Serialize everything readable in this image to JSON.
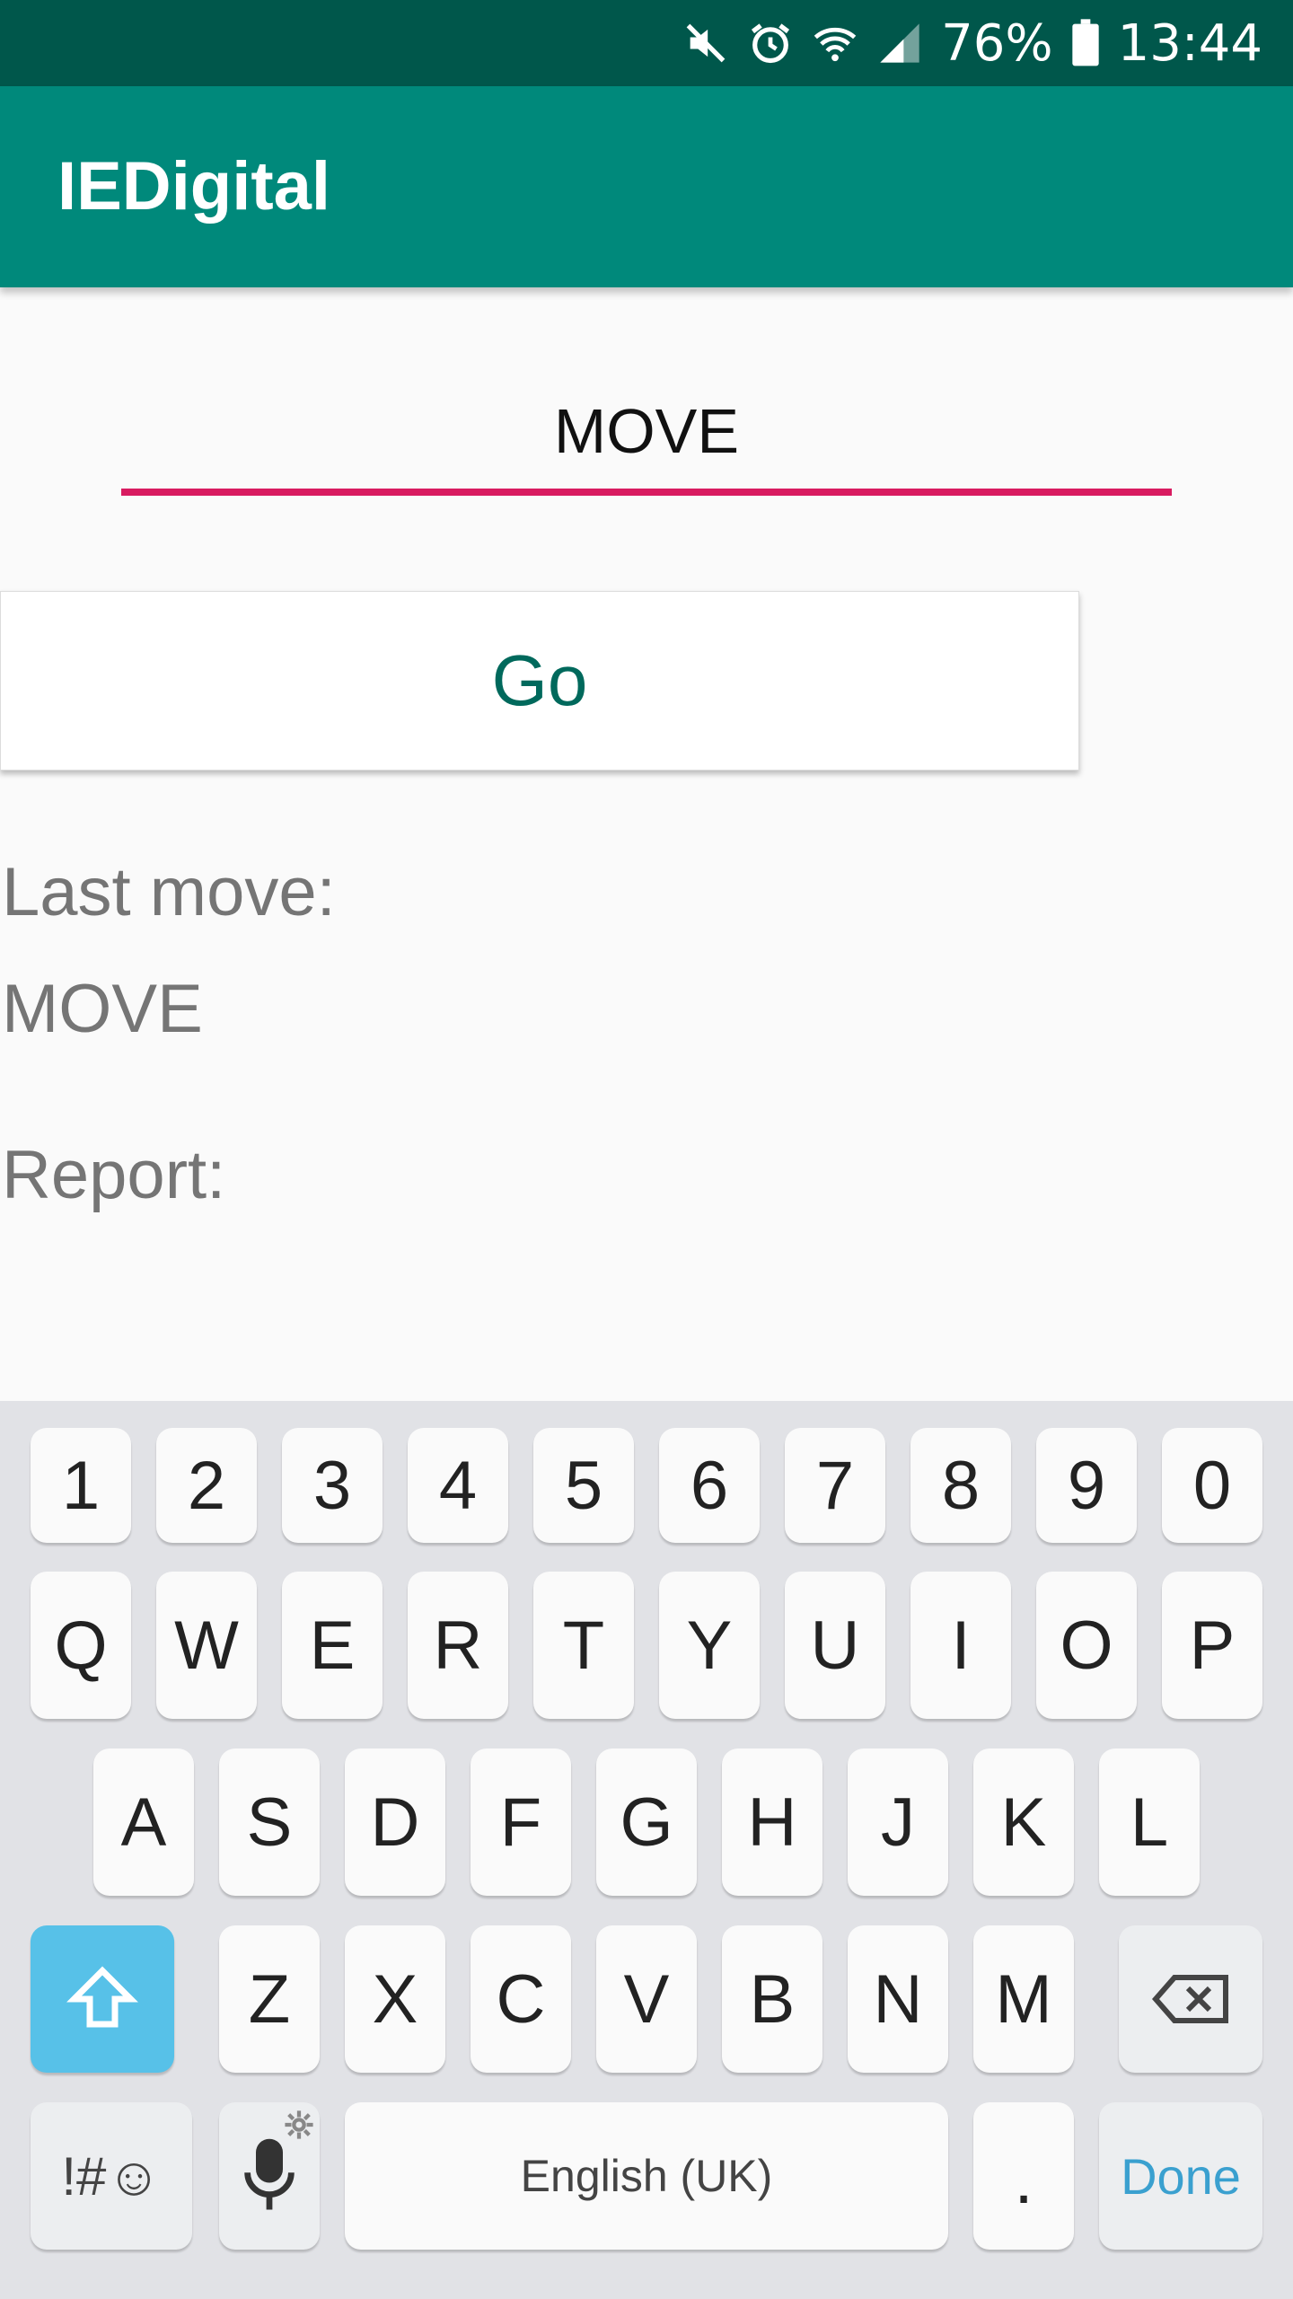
{
  "status_bar": {
    "battery_percent": "76%",
    "time": "13:44",
    "icons": [
      "mute-icon",
      "alarm-icon",
      "wifi-icon",
      "signal-icon",
      "battery-icon"
    ]
  },
  "app_bar": {
    "title": "IEDigital"
  },
  "move_input": {
    "value": "MOVE",
    "underline_color": "#d81b60"
  },
  "go_button": {
    "label": "Go"
  },
  "last_move": {
    "label": "Last move:",
    "value": "MOVE"
  },
  "report": {
    "label": "Report:"
  },
  "keyboard": {
    "row_numbers": [
      "1",
      "2",
      "3",
      "4",
      "5",
      "6",
      "7",
      "8",
      "9",
      "0"
    ],
    "row_top": [
      "Q",
      "W",
      "E",
      "R",
      "T",
      "Y",
      "U",
      "I",
      "O",
      "P"
    ],
    "row_mid": [
      "A",
      "S",
      "D",
      "F",
      "G",
      "H",
      "J",
      "K",
      "L"
    ],
    "row_bottom": [
      "Z",
      "X",
      "C",
      "V",
      "B",
      "N",
      "M"
    ],
    "symbols_label": "!#☺",
    "space_label": "English (UK)",
    "period_label": ".",
    "done_label": "Done"
  },
  "colors": {
    "status_bar": "#00574b",
    "app_bar": "#00897b",
    "accent": "#d81b60",
    "button_text": "#00695c",
    "shift_key": "#57c1e8",
    "done_text": "#3aa0cf"
  }
}
